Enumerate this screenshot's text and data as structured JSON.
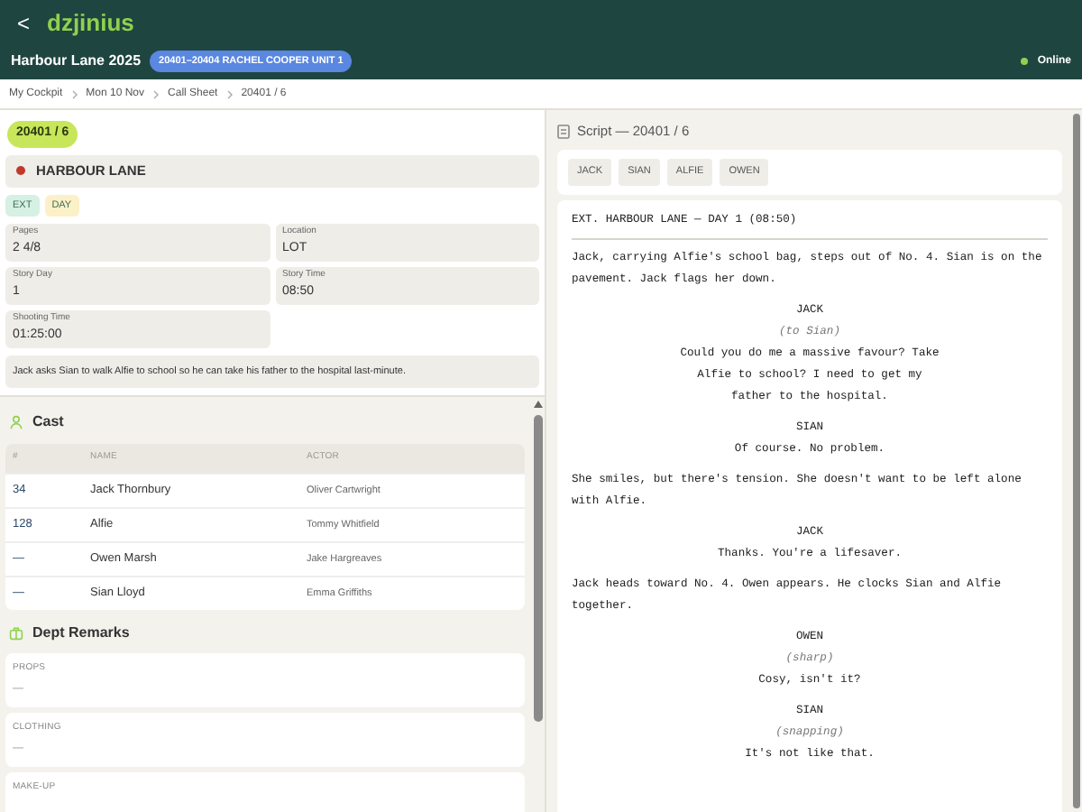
{
  "app": {
    "back": "<",
    "title": "dzjinius"
  },
  "project": {
    "name": "Harbour Lane 2025",
    "badge": "20401–20404 RACHEL COOPER UNIT 1",
    "status": "Online"
  },
  "breadcrumb": [
    "My Cockpit",
    "Mon 10 Nov",
    "Call Sheet",
    "20401 / 6"
  ],
  "scene": {
    "number": "20401 / 6",
    "location": "HARBOUR LANE",
    "tags": [
      {
        "label": "EXT",
        "color": "#d6f0e4"
      },
      {
        "label": "DAY",
        "color": "#fbf0c8"
      }
    ],
    "fields": [
      {
        "label": "Pages",
        "value": "2 4/8"
      },
      {
        "label": "Location",
        "value": "LOT"
      },
      {
        "label": "Story Day",
        "value": "1"
      },
      {
        "label": "Story Time",
        "value": "08:50"
      },
      {
        "label": "Shooting Time",
        "value": "01:25:00"
      }
    ],
    "summary": "Jack asks Sian to walk Alfie to school so he can take his father to the hospital last-minute."
  },
  "cast": {
    "title": "Cast",
    "columns": [
      "#",
      "NAME",
      "ACTOR"
    ],
    "rows": [
      {
        "number": "34",
        "name": "Jack Thornbury",
        "actor": "Oliver Cartwright"
      },
      {
        "number": "128",
        "name": "Alfie",
        "actor": "Tommy Whitfield"
      },
      {
        "number": "—",
        "name": "Owen Marsh",
        "actor": "Jake Hargreaves"
      },
      {
        "number": "—",
        "name": "Sian Lloyd",
        "actor": "Emma Griffiths"
      }
    ]
  },
  "dept_remarks": {
    "title": "Dept Remarks",
    "items": [
      {
        "label": "PROPS",
        "value": "—"
      },
      {
        "label": "CLOTHING",
        "value": "—"
      },
      {
        "label": "MAKE-UP"
      }
    ]
  },
  "script": {
    "title": "Script — 20401 / 6",
    "characters": [
      "JACK",
      "SIAN",
      "ALFIE",
      "OWEN"
    ],
    "blocks": [
      {
        "kind": "heading",
        "text": "EXT. HARBOUR LANE — DAY 1 (08:50)"
      },
      {
        "kind": "action",
        "text": "Jack, carrying Alfie's school bag, steps out of No. 4. Sian is on the pavement. Jack flags her down."
      },
      {
        "kind": "character",
        "text": "JACK"
      },
      {
        "kind": "parenthetical",
        "text": "(to Sian)"
      },
      {
        "kind": "dialogue",
        "text": "Could you do me a massive favour? Take Alfie to school? I need to get my father to the hospital."
      },
      {
        "kind": "character",
        "text": "SIAN"
      },
      {
        "kind": "dialogue",
        "text": "Of course. No problem."
      },
      {
        "kind": "action",
        "text": "She smiles, but there's tension. She doesn't want to be left alone with Alfie."
      },
      {
        "kind": "character",
        "text": "JACK"
      },
      {
        "kind": "dialogue",
        "text": "Thanks. You're a lifesaver."
      },
      {
        "kind": "action",
        "text": "Jack heads toward No. 4. Owen appears. He clocks Sian and Alfie together."
      },
      {
        "kind": "character",
        "text": "OWEN"
      },
      {
        "kind": "parenthetical",
        "text": "(sharp)"
      },
      {
        "kind": "dialogue",
        "text": "Cosy, isn't it?"
      },
      {
        "kind": "character",
        "text": "SIAN"
      },
      {
        "kind": "parenthetical",
        "text": "(snapping)"
      },
      {
        "kind": "dialogue",
        "text": "It's not like that."
      }
    ]
  }
}
